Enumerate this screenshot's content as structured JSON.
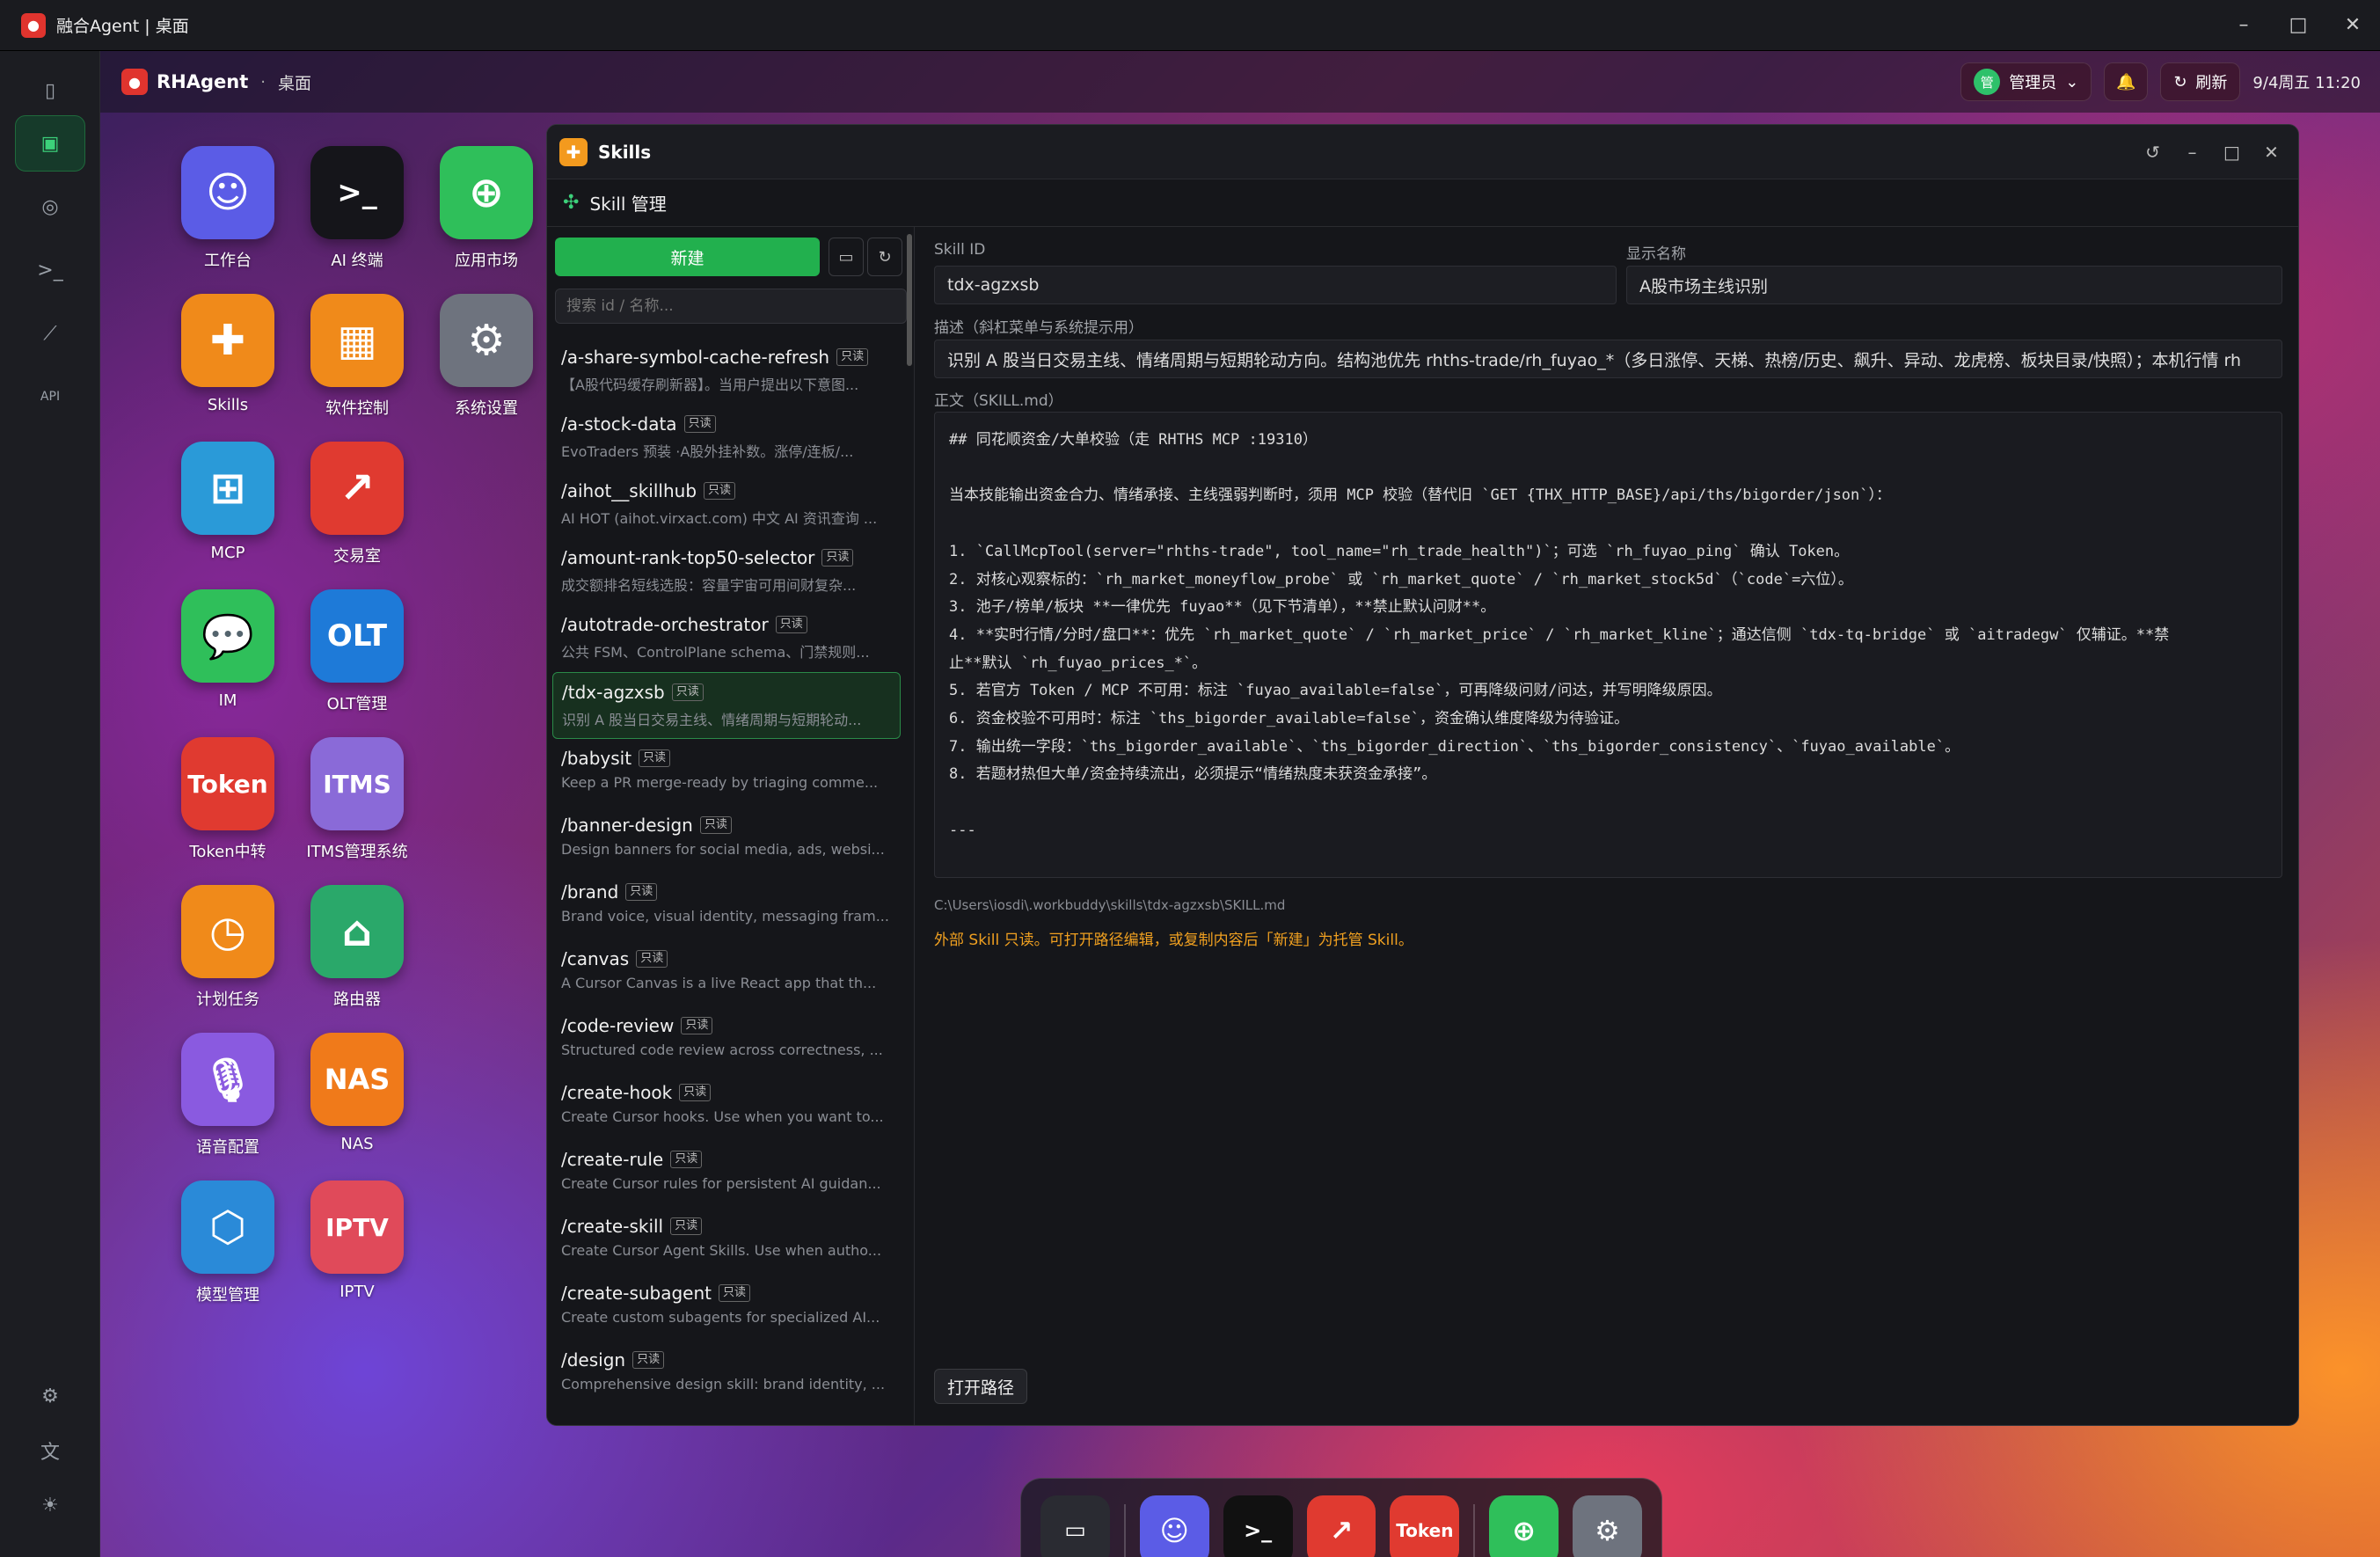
{
  "window_title": "融合Agent | 桌面",
  "sidebar": {
    "icons": [
      "monitor-icon",
      "robot-icon",
      "terminal-icon",
      "chart-icon",
      "api-icon",
      "gear-icon",
      "translate-icon",
      "sun-icon"
    ],
    "api_label": "API"
  },
  "topbar": {
    "brand": "RHAgent",
    "crumb": "桌面",
    "user": "管理员",
    "user_avatar": "管",
    "refresh": "刷新",
    "time": "9/4周五 11:20"
  },
  "desktop_icons": [
    {
      "label": "工作台",
      "color": "#5b5ce6"
    },
    {
      "label": "AI 终端",
      "color": "#222"
    },
    {
      "label": "应用市场",
      "color": "#2fbf5a"
    },
    {
      "label": "Skills",
      "color": "#f08a1a"
    },
    {
      "label": "软件控制",
      "color": "#f08a1a"
    },
    {
      "label": "系统设置",
      "color": "#7a7f8a"
    },
    {
      "label": "MCP",
      "color": "#2a9ad8"
    },
    {
      "label": "交易室",
      "color": "#e03a30"
    },
    {
      "label": "IM",
      "color": "#2fbf5a"
    },
    {
      "label": "OLT管理",
      "color": "#1e7ad8"
    },
    {
      "label": "Token中转",
      "color": "#e03a30"
    },
    {
      "label": "ITMS管理系统",
      "color": "#8a6ad8"
    },
    {
      "label": "计划任务",
      "color": "#f08a1a"
    },
    {
      "label": "路由器",
      "color": "#2aa86a"
    },
    {
      "label": "语音配置",
      "color": "#8a5ae0"
    },
    {
      "label": "NAS",
      "color": "#f07a1a"
    },
    {
      "label": "模型管理",
      "color": "#2a8ad8"
    },
    {
      "label": "IPTV",
      "color": "#e04a5a"
    }
  ],
  "icon_glyphs": {
    "ai_terminal": ">_",
    "token": "Token",
    "nas": "NAS",
    "iptv": "IPTV",
    "olt": "OLT",
    "itms": "ITMS"
  },
  "skills_window": {
    "title": "Skills",
    "subtitle": "Skill 管理",
    "new_label": "新建",
    "search_placeholder": "搜索 id / 名称...",
    "readonly": "只读",
    "items": [
      {
        "name": "/a-share-symbol-cache-refresh",
        "desc": "【A股代码缓存刷新器】。当用户提出以下意图..."
      },
      {
        "name": "/a-stock-data",
        "desc": "EvoTraders 预装 ·A股外挂补数。涨停/连板/..."
      },
      {
        "name": "/aihot__skillhub",
        "desc": "AI HOT (aihot.virxact.com) 中文 AI 资讯查询 ..."
      },
      {
        "name": "/amount-rank-top50-selector",
        "desc": "成交额排名短线选股：容量宇宙可用间财复杂..."
      },
      {
        "name": "/autotrade-orchestrator",
        "desc": "公共 FSM、ControlPlane schema、门禁规则..."
      },
      {
        "name": "/tdx-agzxsb",
        "desc": "识别 A 股当日交易主线、情绪周期与短期轮动..."
      },
      {
        "name": "/babysit",
        "desc": "Keep a PR merge-ready by triaging comme..."
      },
      {
        "name": "/banner-design",
        "desc": "Design banners for social media, ads, websi..."
      },
      {
        "name": "/brand",
        "desc": "Brand voice, visual identity, messaging fram..."
      },
      {
        "name": "/canvas",
        "desc": "A Cursor Canvas is a live React app that th..."
      },
      {
        "name": "/code-review",
        "desc": "Structured code review across correctness, ..."
      },
      {
        "name": "/create-hook",
        "desc": "Create Cursor hooks. Use when you want to..."
      },
      {
        "name": "/create-rule",
        "desc": "Create Cursor rules for persistent AI guidan..."
      },
      {
        "name": "/create-skill",
        "desc": "Create Cursor Agent Skills. Use when autho..."
      },
      {
        "name": "/create-subagent",
        "desc": "Create custom subagents for specialized AI..."
      },
      {
        "name": "/design",
        "desc": "Comprehensive design skill: brand identity, ..."
      }
    ],
    "skill_id_label": "Skill ID",
    "skill_id": "tdx-agzxsb",
    "display_name_label": "显示名称",
    "display_name": "A股市场主线识别",
    "desc_label": "描述（斜杠菜单与系统提示用）",
    "desc": "识别 A 股当日交易主线、情绪周期与短期轮动方向。结构池优先 rhths-trade/rh_fuyao_*（多日涨停、天梯、热榜/历史、飙升、异动、龙虎榜、板块目录/快照）；本机行情 rh",
    "body_label": "正文（SKILL.md）",
    "body_lines": [
      "## 同花顺资金/大单校验（走 RHTHS MCP :19310）",
      "",
      "当本技能输出资金合力、情绪承接、主线强弱判断时，须用 MCP 校验（替代旧 `GET {THX_HTTP_BASE}/api/ths/bigorder/json`）：",
      "",
      "1. `CallMcpTool(server=\"rhths-trade\", tool_name=\"rh_trade_health\")`；可选 `rh_fuyao_ping` 确认 Token。",
      "2. 对核心观察标的：`rh_market_moneyflow_probe` 或 `rh_market_quote` / `rh_market_stock5d`（`code`=六位）。",
      "3. 池子/榜单/板块 **一律优先 fuyao**（见下节清单），**禁止默认问财**。",
      "4. **实时行情/分时/盘口**：优先 `rh_market_quote` / `rh_market_price` / `rh_market_kline`；通达信侧 `tdx-tq-bridge` 或 `aitradegw` 仅辅证。**禁",
      "止**默认 `rh_fuyao_prices_*`。",
      "5. 若官方 Token / MCP 不可用：标注 `fuyao_available=false`，可再降级问财/问达，并写明降级原因。",
      "6. 资金校验不可用时：标注 `ths_bigorder_available=false`，资金确认维度降级为待验证。",
      "7. 输出统一字段：`ths_bigorder_available`、`ths_bigorder_direction`、`ths_bigorder_consistency`、`fuyao_available`。",
      "8. 若题材热但大单/资金持续流出，必须提示“情绪热度未获资金承接”。",
      "",
      "---"
    ],
    "file_path": "C:\\Users\\iosdi\\.workbuddy\\skills\\tdx-agzxsb\\SKILL.md",
    "warning": "外部 Skill 只读。可打开路径编辑，或复制内容后「新建」为托管 Skill。",
    "open_path": "打开路径"
  },
  "dock": [
    {
      "name": "desktop",
      "color": "#2a2b32"
    },
    {
      "name": "workbench",
      "color": "#5b5ce6"
    },
    {
      "name": "ai-terminal",
      "color": "#111"
    },
    {
      "name": "trading",
      "color": "#e03a30"
    },
    {
      "name": "token",
      "color": "#e03a30"
    },
    {
      "name": "app-market",
      "color": "#2fbf5a"
    },
    {
      "name": "settings",
      "color": "#7a7f8a"
    }
  ],
  "dock_token_label": "Token"
}
